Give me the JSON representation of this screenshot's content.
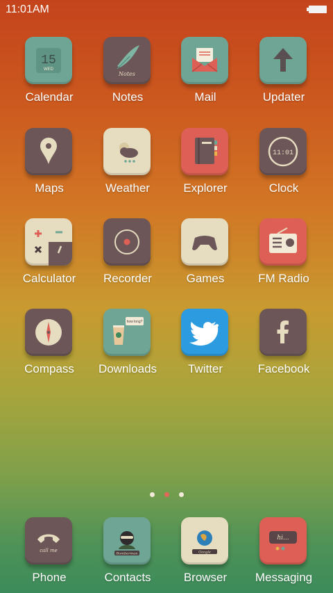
{
  "status": {
    "time": "11:01AM",
    "battery_icon": "battery-icon"
  },
  "colors": {
    "teal": "#6fa595",
    "plum": "#6c5658",
    "beige": "#e6dcc0",
    "coral": "#dd5f55",
    "twitter_blue": "#2d9be0",
    "active_dot": "#e2695a"
  },
  "apps": [
    {
      "label": "Calendar",
      "icon": "calendar-icon",
      "day": "15",
      "weekday": "WED"
    },
    {
      "label": "Notes",
      "icon": "notes-icon",
      "caption": "Notes"
    },
    {
      "label": "Mail",
      "icon": "mail-icon"
    },
    {
      "label": "Updater",
      "icon": "updater-icon"
    },
    {
      "label": "Maps",
      "icon": "maps-icon"
    },
    {
      "label": "Weather",
      "icon": "weather-icon"
    },
    {
      "label": "Explorer",
      "icon": "explorer-icon"
    },
    {
      "label": "Clock",
      "icon": "clock-icon",
      "time": "11:01"
    },
    {
      "label": "Calculator",
      "icon": "calculator-icon"
    },
    {
      "label": "Recorder",
      "icon": "recorder-icon"
    },
    {
      "label": "Games",
      "icon": "games-icon"
    },
    {
      "label": "FM Radio",
      "icon": "radio-icon"
    },
    {
      "label": "Compass",
      "icon": "compass-icon"
    },
    {
      "label": "Downloads",
      "icon": "downloads-icon",
      "caption": "how long?"
    },
    {
      "label": "Twitter",
      "icon": "twitter-icon"
    },
    {
      "label": "Facebook",
      "icon": "facebook-icon"
    }
  ],
  "pager": {
    "count": 3,
    "active_index": 1
  },
  "dock": [
    {
      "label": "Phone",
      "icon": "phone-icon",
      "caption": "call me"
    },
    {
      "label": "Contacts",
      "icon": "contacts-icon",
      "caption": "Bomberman"
    },
    {
      "label": "Browser",
      "icon": "browser-icon",
      "caption": "Google"
    },
    {
      "label": "Messaging",
      "icon": "messaging-icon",
      "caption": "hi..."
    }
  ]
}
